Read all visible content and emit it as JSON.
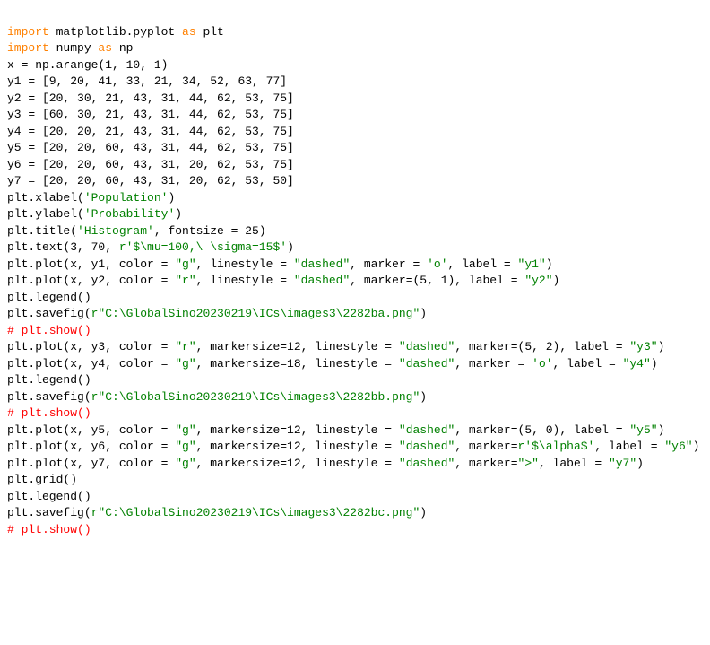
{
  "chart_data": null,
  "code_lines": [
    [
      [
        "kw",
        "import"
      ],
      [
        "blk",
        " matplotlib.pyplot "
      ],
      [
        "kw",
        "as"
      ],
      [
        "blk",
        " plt"
      ]
    ],
    [
      [
        "kw",
        "import"
      ],
      [
        "blk",
        " numpy "
      ],
      [
        "kw",
        "as"
      ],
      [
        "blk",
        " np"
      ]
    ],
    [
      [
        "blk",
        ""
      ]
    ],
    [
      [
        "blk",
        "x = np.arange(1, 10, 1)"
      ]
    ],
    [
      [
        "blk",
        "y1 = [9, 20, 41, 33, 21, 34, 52, 63, 77]"
      ]
    ],
    [
      [
        "blk",
        "y2 = [20, 30, 21, 43, 31, 44, 62, 53, 75]"
      ]
    ],
    [
      [
        "blk",
        "y3 = [60, 30, 21, 43, 31, 44, 62, 53, 75]"
      ]
    ],
    [
      [
        "blk",
        "y4 = [20, 20, 21, 43, 31, 44, 62, 53, 75]"
      ]
    ],
    [
      [
        "blk",
        "y5 = [20, 20, 60, 43, 31, 44, 62, 53, 75]"
      ]
    ],
    [
      [
        "blk",
        "y6 = [20, 20, 60, 43, 31, 20, 62, 53, 75]"
      ]
    ],
    [
      [
        "blk",
        "y7 = [20, 20, 60, 43, 31, 20, 62, 53, 50]"
      ]
    ],
    [
      [
        "blk",
        ""
      ]
    ],
    [
      [
        "blk",
        ""
      ]
    ],
    [
      [
        "blk",
        "plt.xlabel("
      ],
      [
        "str",
        "'Population'"
      ],
      [
        "blk",
        ")"
      ]
    ],
    [
      [
        "blk",
        "plt.ylabel("
      ],
      [
        "str",
        "'Probability'"
      ],
      [
        "blk",
        ")"
      ]
    ],
    [
      [
        "blk",
        "plt.title("
      ],
      [
        "str",
        "'Histogram'"
      ],
      [
        "blk",
        ", fontsize = 25)"
      ]
    ],
    [
      [
        "blk",
        "plt.text(3, 70, "
      ],
      [
        "str",
        "r'$\\mu=100,\\ \\sigma=15$'"
      ],
      [
        "blk",
        ")"
      ]
    ],
    [
      [
        "blk",
        "plt.plot(x, y1, color = "
      ],
      [
        "str",
        "\"g\""
      ],
      [
        "blk",
        ", linestyle = "
      ],
      [
        "str",
        "\"dashed\""
      ],
      [
        "blk",
        ", marker = "
      ],
      [
        "str",
        "'o'"
      ],
      [
        "blk",
        ", label = "
      ],
      [
        "str",
        "\"y1\""
      ],
      [
        "blk",
        ")"
      ]
    ],
    [
      [
        "blk",
        "plt.plot(x, y2, color = "
      ],
      [
        "str",
        "\"r\""
      ],
      [
        "blk",
        ", linestyle = "
      ],
      [
        "str",
        "\"dashed\""
      ],
      [
        "blk",
        ", marker=(5, 1), label = "
      ],
      [
        "str",
        "\"y2\""
      ],
      [
        "blk",
        ")"
      ]
    ],
    [
      [
        "blk",
        "plt.legend()"
      ]
    ],
    [
      [
        "blk",
        "plt.savefig("
      ],
      [
        "str",
        "r\"C:\\GlobalSino20230219\\ICs\\images3\\2282ba.png\""
      ],
      [
        "blk",
        ")"
      ]
    ],
    [
      [
        "com",
        "# plt.show()"
      ]
    ],
    [
      [
        "blk",
        ""
      ]
    ],
    [
      [
        "blk",
        ""
      ]
    ],
    [
      [
        "blk",
        "plt.plot(x, y3, color = "
      ],
      [
        "str",
        "\"r\""
      ],
      [
        "blk",
        ", markersize=12, linestyle = "
      ],
      [
        "str",
        "\"dashed\""
      ],
      [
        "blk",
        ", marker=(5, 2), label = "
      ],
      [
        "str",
        "\"y3\""
      ],
      [
        "blk",
        ")"
      ]
    ],
    [
      [
        "blk",
        "plt.plot(x, y4, color = "
      ],
      [
        "str",
        "\"g\""
      ],
      [
        "blk",
        ", markersize=18, linestyle = "
      ],
      [
        "str",
        "\"dashed\""
      ],
      [
        "blk",
        ", marker = "
      ],
      [
        "str",
        "'o'"
      ],
      [
        "blk",
        ", label = "
      ],
      [
        "str",
        "\"y4\""
      ],
      [
        "blk",
        ")"
      ]
    ],
    [
      [
        "blk",
        "plt.legend()"
      ]
    ],
    [
      [
        "blk",
        "plt.savefig("
      ],
      [
        "str",
        "r\"C:\\GlobalSino20230219\\ICs\\images3\\2282bb.png\""
      ],
      [
        "blk",
        ")"
      ]
    ],
    [
      [
        "com",
        "# plt.show()"
      ]
    ],
    [
      [
        "blk",
        ""
      ]
    ],
    [
      [
        "blk",
        "plt.plot(x, y5, color = "
      ],
      [
        "str",
        "\"g\""
      ],
      [
        "blk",
        ", markersize=12, linestyle = "
      ],
      [
        "str",
        "\"dashed\""
      ],
      [
        "blk",
        ", marker=(5, 0), label = "
      ],
      [
        "str",
        "\"y5\""
      ],
      [
        "blk",
        ")"
      ]
    ],
    [
      [
        "blk",
        "plt.plot(x, y6, color = "
      ],
      [
        "str",
        "\"g\""
      ],
      [
        "blk",
        ", markersize=12, linestyle = "
      ],
      [
        "str",
        "\"dashed\""
      ],
      [
        "blk",
        ", marker="
      ],
      [
        "str",
        "r'$\\alpha$'"
      ],
      [
        "blk",
        ", label = "
      ],
      [
        "str",
        "\"y6\""
      ],
      [
        "blk",
        ")"
      ]
    ],
    [
      [
        "blk",
        "plt.plot(x, y7, color = "
      ],
      [
        "str",
        "\"g\""
      ],
      [
        "blk",
        ", markersize=12, linestyle = "
      ],
      [
        "str",
        "\"dashed\""
      ],
      [
        "blk",
        ", marker="
      ],
      [
        "str",
        "\">\""
      ],
      [
        "blk",
        ", label = "
      ],
      [
        "str",
        "\"y7\""
      ],
      [
        "blk",
        ")"
      ]
    ],
    [
      [
        "blk",
        "plt.grid()"
      ]
    ],
    [
      [
        "blk",
        "plt.legend()"
      ]
    ],
    [
      [
        "blk",
        "plt.savefig("
      ],
      [
        "str",
        "r\"C:\\GlobalSino20230219\\ICs\\images3\\2282bc.png\""
      ],
      [
        "blk",
        ")"
      ]
    ],
    [
      [
        "com",
        "# plt.show()"
      ]
    ]
  ]
}
